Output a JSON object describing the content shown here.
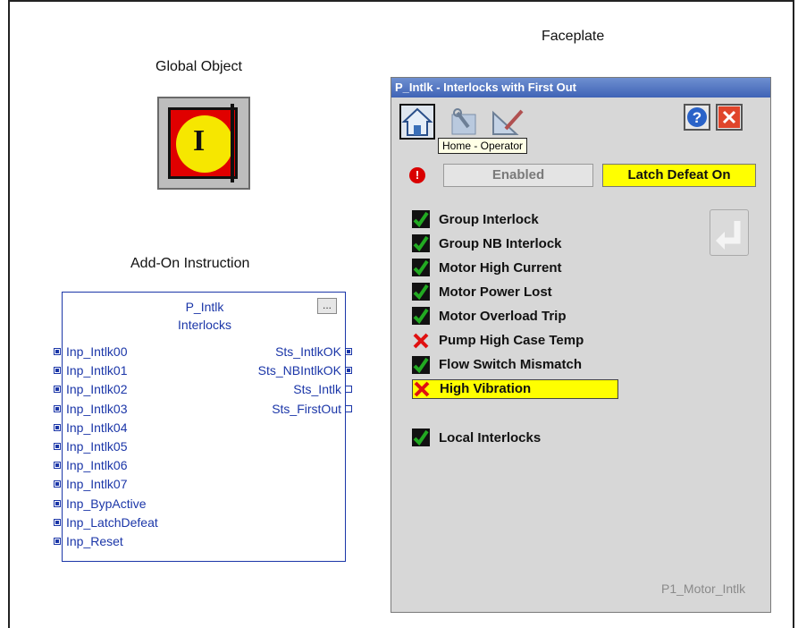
{
  "captions": {
    "faceplate": "Faceplate",
    "global_object": "Global Object",
    "aoi": "Add-On Instruction"
  },
  "aoi": {
    "name": "P_Intlk",
    "description": "Interlocks",
    "config_button": "...",
    "inputs": [
      "Inp_Intlk00",
      "Inp_Intlk01",
      "Inp_Intlk02",
      "Inp_Intlk03",
      "Inp_Intlk04",
      "Inp_Intlk05",
      "Inp_Intlk06",
      "Inp_Intlk07",
      "Inp_BypActive",
      "Inp_LatchDefeat",
      "Inp_Reset"
    ],
    "outputs": [
      "Sts_IntlkOK",
      "Sts_NBIntlkOK",
      "Sts_Intlk",
      "Sts_FirstOut"
    ]
  },
  "faceplate": {
    "title": "P_Intlk - Interlocks with First Out",
    "tooltip": "Home - Operator",
    "status_enabled": "Enabled",
    "status_latch": "Latch Defeat On",
    "interlocks": [
      {
        "label": "Group Interlock",
        "state": "ok"
      },
      {
        "label": "Group NB Interlock",
        "state": "ok"
      },
      {
        "label": "Motor High Current",
        "state": "ok"
      },
      {
        "label": "Motor Power Lost",
        "state": "ok"
      },
      {
        "label": "Motor Overload Trip",
        "state": "ok"
      },
      {
        "label": "Pump High Case Temp",
        "state": "fault"
      },
      {
        "label": "Flow Switch Mismatch",
        "state": "ok"
      },
      {
        "label": "High Vibration",
        "state": "fault"
      }
    ],
    "local": {
      "label": "Local Interlocks",
      "state": "ok"
    },
    "tag": "P1_Motor_Intlk"
  },
  "colors": {
    "ok": "#22aa22",
    "fault": "#e01010",
    "highlight": "#ffff00",
    "aoi": "#1b36a8"
  }
}
